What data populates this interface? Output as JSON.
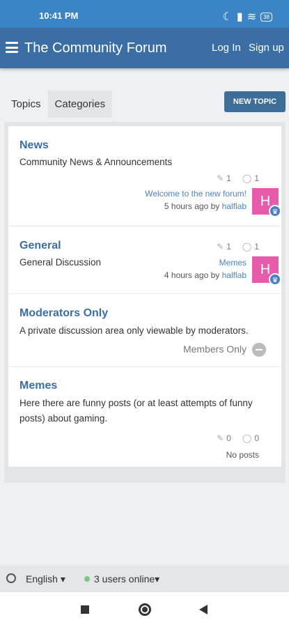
{
  "status_bar": {
    "time": "10:41 PM",
    "battery": "38"
  },
  "header": {
    "title": "The Community Forum",
    "login": "Log In",
    "signup": "Sign up"
  },
  "tabs": [
    {
      "label": "Topics"
    },
    {
      "label": "Categories"
    }
  ],
  "new_topic_label": "NEW TOPIC",
  "categories": [
    {
      "title": "News",
      "description": "Community News & Announcements",
      "topics": "1",
      "posts": "1",
      "last_post": {
        "title": "Welcome to the new forum!",
        "time": "5 hours ago by",
        "user": "halflab",
        "avatar_letter": "H"
      }
    },
    {
      "title": "General",
      "description": "General Discussion",
      "topics": "1",
      "posts": "1",
      "last_post": {
        "title": "Memes",
        "time": "4 hours ago by",
        "user": "halflab",
        "avatar_letter": "H"
      }
    },
    {
      "title": "Moderators Only",
      "description": "A private discussion area only viewable by moderators.",
      "restriction": "Members Only"
    },
    {
      "title": "Memes",
      "description": "Here there are funny posts (or at least attempts of funny posts) about gaming.",
      "topics": "0",
      "posts": "0",
      "no_posts": "No posts"
    }
  ],
  "footer": {
    "language": "English",
    "online": "3 users online"
  },
  "colors": {
    "status_bar": "#3b84c7",
    "app_bar": "#3a6ea5",
    "accent": "#3a6ea5",
    "avatar": "#e85aaa"
  }
}
